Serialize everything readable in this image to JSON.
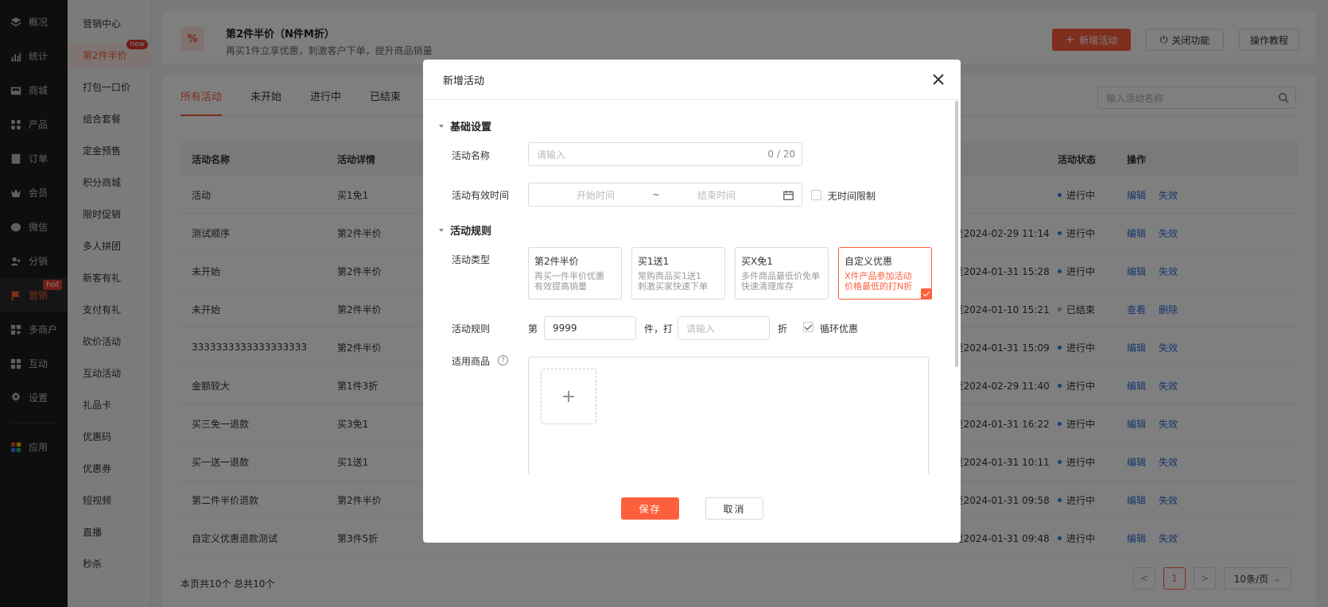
{
  "nav": {
    "items": [
      {
        "label": "概况",
        "icon": "layers-icon"
      },
      {
        "label": "统计",
        "icon": "chart-icon"
      },
      {
        "label": "商城",
        "icon": "store-icon"
      },
      {
        "label": "产品",
        "icon": "grid-icon"
      },
      {
        "label": "订单",
        "icon": "order-icon"
      },
      {
        "label": "会员",
        "icon": "crown-icon"
      },
      {
        "label": "微信",
        "icon": "wechat-icon"
      },
      {
        "label": "分销",
        "icon": "share-icon"
      },
      {
        "label": "营销",
        "icon": "flag-icon",
        "badge": "hot"
      },
      {
        "label": "多商户",
        "icon": "merchant-icon"
      },
      {
        "label": "互动",
        "icon": "interact-icon"
      },
      {
        "label": "设置",
        "icon": "gear-icon"
      },
      {
        "label": "应用",
        "icon": "apps-icon"
      }
    ]
  },
  "submenu": {
    "items": [
      {
        "label": "营销中心"
      },
      {
        "label": "第2件半价",
        "badge": "new"
      },
      {
        "label": "打包一口价"
      },
      {
        "label": "组合套餐"
      },
      {
        "label": "定金预售"
      },
      {
        "label": "积分商城"
      },
      {
        "label": "限时促销"
      },
      {
        "label": "多人拼团"
      },
      {
        "label": "新客有礼"
      },
      {
        "label": "支付有礼"
      },
      {
        "label": "砍价活动"
      },
      {
        "label": "互动活动"
      },
      {
        "label": "礼品卡"
      },
      {
        "label": "优惠码"
      },
      {
        "label": "优惠券"
      },
      {
        "label": "短视频"
      },
      {
        "label": "直播"
      },
      {
        "label": "秒杀"
      }
    ]
  },
  "header": {
    "icon_text": "%",
    "title": "第2件半价（N件M折）",
    "desc": "再买1件立享优惠，刺激客户下单，提升商品销量",
    "new_activity": "新增活动",
    "close_feature": "关闭功能",
    "tutorial": "操作教程"
  },
  "tabs": [
    "所有活动",
    "未开始",
    "进行中",
    "已结束"
  ],
  "search": {
    "placeholder": "输入活动名称"
  },
  "table": {
    "headers": {
      "name": "活动名称",
      "detail": "活动详情",
      "status": "活动状态",
      "ops": "操作"
    },
    "rows": [
      {
        "name": "活动",
        "detail": "买1免1",
        "time": "",
        "status": "进行中",
        "op1": "编辑",
        "op2": "失效"
      },
      {
        "name": "测试顺序",
        "detail": "第2件半价",
        "time": "11:14至2024-02-29 11:14",
        "status": "进行中",
        "op1": "编辑",
        "op2": "失效"
      },
      {
        "name": "未开始",
        "detail": "第2件半价",
        "time": "15:28至2024-01-31 15:28",
        "status": "进行中",
        "op1": "编辑",
        "op2": "失效"
      },
      {
        "name": "未开始",
        "detail": "第2件半价",
        "time": "12:21至2024-01-10 15:21",
        "status": "已结束",
        "op1": "查看",
        "op2": "删除"
      },
      {
        "name": "3333333333333333333",
        "detail": "第2件半价",
        "time": "15:09至2024-01-31 15:09",
        "status": "进行中",
        "op1": "编辑",
        "op2": "失效"
      },
      {
        "name": "金额较大",
        "detail": "第1件3折",
        "time": "11:40至2024-02-29 11:40",
        "status": "进行中",
        "op1": "编辑",
        "op2": "失效"
      },
      {
        "name": "买三免一退款",
        "detail": "买3免1",
        "time": "16:22至2024-01-31 16:22",
        "status": "进行中",
        "op1": "编辑",
        "op2": "失效"
      },
      {
        "name": "买一送一退款",
        "detail": "买1送1",
        "time": "10:11至2024-01-31 10:11",
        "status": "进行中",
        "op1": "编辑",
        "op2": "失效"
      },
      {
        "name": "第二件半价退款",
        "detail": "第2件半价",
        "time": "09:58至2024-01-31 09:58",
        "status": "进行中",
        "op1": "编辑",
        "op2": "失效"
      },
      {
        "name": "自定义优惠退款测试",
        "detail": "第3件5折",
        "time": "09:48至2024-01-31 09:48",
        "status": "进行中",
        "op1": "编辑",
        "op2": "失效"
      }
    ]
  },
  "footer": {
    "summary": "本页共10个 总共10个",
    "prev": "<",
    "page": "1",
    "next": ">",
    "page_size": "10条/页"
  },
  "modal": {
    "title": "新增活动",
    "basic_section": "基础设置",
    "name_label": "活动名称",
    "name_placeholder": "请输入",
    "name_count": "0 / 20",
    "time_label": "活动有效时间",
    "start_placeholder": "开始时间",
    "tilde": "~",
    "end_placeholder": "结束时间",
    "no_limit": "无时间限制",
    "rule_section": "活动规则",
    "type_label": "活动类型",
    "types": [
      {
        "title": "第2件半价",
        "desc1": "再买一件半价优惠",
        "desc2": "有效提高销量"
      },
      {
        "title": "买1送1",
        "desc1": "常购商品买1送1",
        "desc2": "刺激买家快速下单"
      },
      {
        "title": "买X免1",
        "desc1": "多件商品最低价免单",
        "desc2": "快速清理库存"
      },
      {
        "title": "自定义优惠",
        "desc1": "X件产品参加活动",
        "desc2": "价格最低的打N折"
      }
    ],
    "rule_label": "活动规则",
    "rule_prefix": "第",
    "rule_value": "9999",
    "rule_mid": "件，打",
    "rule_placeholder": "请输入",
    "rule_suffix": "折",
    "loop": "循环优惠",
    "goods_label": "适用商品",
    "help": "?",
    "add": "+",
    "save": "保存",
    "cancel": "取消"
  },
  "colors": {
    "accent": "#ff5f3c",
    "link": "#2d6ed8",
    "nav_bg": "#1c1c1c"
  }
}
